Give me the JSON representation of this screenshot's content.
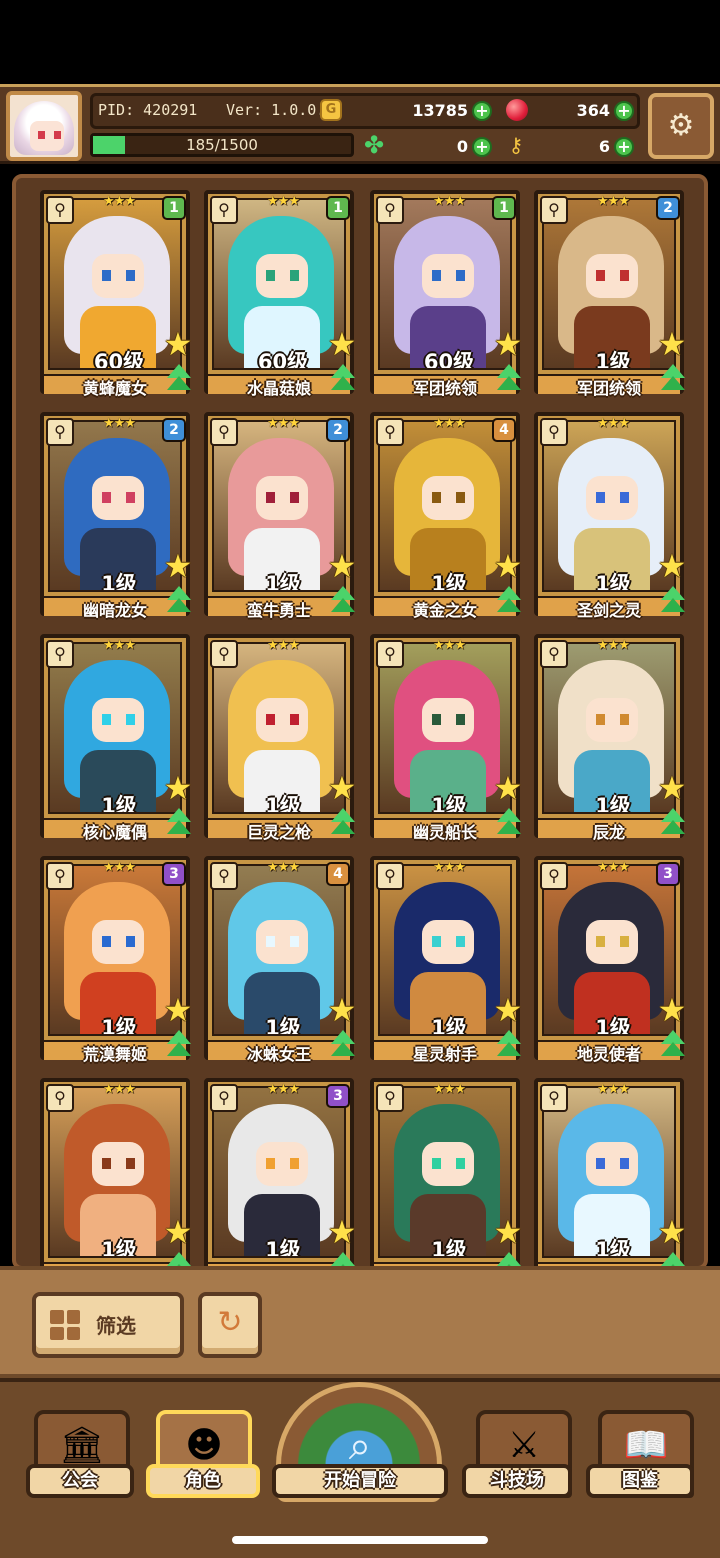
{
  "header": {
    "pid_label": "PID: 420291",
    "version_label": "Ver: 1.0.0.6",
    "gold": "13785",
    "gems": "364",
    "xp": "185/1500",
    "xp_fraction": 0.123,
    "clovers": "0",
    "keys": "6"
  },
  "roster": [
    {
      "name": "黄蜂魔女",
      "level": "60级",
      "badge": "1",
      "badge_color": "#5fb84f",
      "palette": [
        "#e9e4ee",
        "#f0a830",
        "#2d6cc8"
      ]
    },
    {
      "name": "水晶菇娘",
      "level": "60级",
      "badge": "1",
      "badge_color": "#5fb84f",
      "palette": [
        "#37c7c0",
        "#dff6ff",
        "#2aa37a"
      ]
    },
    {
      "name": "军团统领",
      "level": "60级",
      "badge": "1",
      "badge_color": "#5fb84f",
      "palette": [
        "#c7b8e8",
        "#5a3f8a",
        "#2d6cc8"
      ]
    },
    {
      "name": "军团统领",
      "level": "1级",
      "badge": "2",
      "badge_color": "#3f8fd8",
      "palette": [
        "#d9b889",
        "#7a3a1e",
        "#c03030"
      ]
    },
    {
      "name": "幽暗龙女",
      "level": "1级",
      "badge": "2",
      "badge_color": "#3f8fd8",
      "palette": [
        "#2f6bc0",
        "#2a3a5a",
        "#d04060"
      ]
    },
    {
      "name": "蛮牛勇士",
      "level": "1级",
      "badge": "2",
      "badge_color": "#3f8fd8",
      "palette": [
        "#e89a9a",
        "#f2f2f2",
        "#a0203a"
      ]
    },
    {
      "name": "黄金之女",
      "level": "1级",
      "badge": "4",
      "badge_color": "#d8903f",
      "palette": [
        "#e6b63a",
        "#b8801e",
        "#8a5a10"
      ]
    },
    {
      "name": "圣剑之灵",
      "level": "1级",
      "badge": "",
      "badge_color": "",
      "palette": [
        "#e6eef8",
        "#d8c27a",
        "#3a6ad8"
      ]
    },
    {
      "name": "核心魔偶",
      "level": "1级",
      "badge": "",
      "badge_color": "",
      "palette": [
        "#30a8e0",
        "#2a4a5a",
        "#30d0e8"
      ]
    },
    {
      "name": "巨灵之枪",
      "level": "1级",
      "badge": "",
      "badge_color": "",
      "palette": [
        "#f0c050",
        "#f2f2f2",
        "#c02030"
      ]
    },
    {
      "name": "幽灵船长",
      "level": "1级",
      "badge": "",
      "badge_color": "",
      "palette": [
        "#e05080",
        "#5ab08a",
        "#2a5a3a"
      ]
    },
    {
      "name": "辰龙",
      "level": "1级",
      "badge": "",
      "badge_color": "",
      "palette": [
        "#f0e0c8",
        "#4aa8c8",
        "#d08a30"
      ]
    },
    {
      "name": "荒漠舞姬",
      "level": "1级",
      "badge": "3",
      "badge_color": "#9050c8",
      "palette": [
        "#f0a050",
        "#d04020",
        "#2a6ad0"
      ]
    },
    {
      "name": "冰蛛女王",
      "level": "1级",
      "badge": "4",
      "badge_color": "#d8903f",
      "palette": [
        "#60c8e8",
        "#2a4a6a",
        "#e8f8ff"
      ]
    },
    {
      "name": "星灵射手",
      "level": "1级",
      "badge": "",
      "badge_color": "",
      "palette": [
        "#1a2a6a",
        "#d08a40",
        "#3ad0d0"
      ]
    },
    {
      "name": "地灵使者",
      "level": "1级",
      "badge": "3",
      "badge_color": "#9050c8",
      "palette": [
        "#2a2a3a",
        "#c03020",
        "#d8b040"
      ]
    },
    {
      "name": "",
      "level": "1级",
      "badge": "",
      "badge_color": "",
      "palette": [
        "#c05a2a",
        "#f0b080",
        "#8a3a1a"
      ]
    },
    {
      "name": "",
      "level": "1级",
      "badge": "3",
      "badge_color": "#9050c8",
      "palette": [
        "#e8e8e8",
        "#2a2a3a",
        "#f0a030"
      ]
    },
    {
      "name": "",
      "level": "1级",
      "badge": "",
      "badge_color": "",
      "palette": [
        "#2a7a5a",
        "#5a3a2a",
        "#30d0a0"
      ]
    },
    {
      "name": "",
      "level": "1级",
      "badge": "",
      "badge_color": "",
      "palette": [
        "#5ab8e8",
        "#e8f8ff",
        "#3a6ad8"
      ]
    }
  ],
  "filter": {
    "label": "筛选"
  },
  "nav": {
    "guild": "公会",
    "character": "角色",
    "adventure": "开始冒险",
    "arena": "斗技场",
    "codex": "图鉴"
  }
}
